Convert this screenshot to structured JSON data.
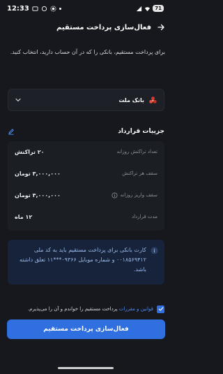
{
  "status_bar": {
    "time": "12:33",
    "battery": "71"
  },
  "header": {
    "title": "فعال‌سازی پرداخت مستقیم"
  },
  "intro": {
    "text": "برای پرداخت مستقیم، بانکی را که در آن حساب دارید، انتخاب کنید."
  },
  "bank": {
    "name": "بانک ملت"
  },
  "details": {
    "title": "جزییات قرارداد",
    "rows": [
      {
        "label": "تعداد تراکنش روزانه",
        "value": "۲۰ تراکنش"
      },
      {
        "label": "سقف هر تراکنش",
        "value": "۳,۰۰۰,۰۰۰ تومان"
      },
      {
        "label": "سقف واریز روزانه",
        "value": "۳,۰۰۰,۰۰۰ تومان"
      },
      {
        "label": "مدت قرارداد",
        "value": "۱۲ ماه"
      }
    ]
  },
  "notice": {
    "text": "کارت بانکی برای پرداخت مستقیم باید به کد ملی ۰۰۱۸۵۶۹۴۱۲ و شماره موبایل ۰۹۳۶۶***۱۱ تعلق داشته باشد."
  },
  "terms": {
    "link": "قوانین و مقررات",
    "suffix": " پرداخت مستقیم را خواندم و آن را می‌پذیرم."
  },
  "actions": {
    "primary": "فعال‌سازی پرداخت مستقیم"
  },
  "colors": {
    "background": "#16181d",
    "accent": "#2f6fe0",
    "notice_bg": "#16233b",
    "notice_text": "#9dbbea"
  }
}
